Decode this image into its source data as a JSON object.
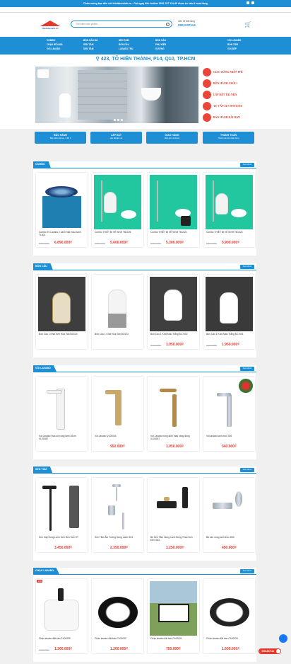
{
  "topbar": {
    "notice": "Chào mừng bạn đến với thietbivesinh.vn - Gọi ngay đến hotline 0901 237 114 để được tư vấn & mua hàng"
  },
  "header": {
    "search_placeholder": "Tìm kiếm sản phẩm...",
    "hotline_label": "Liên hệ đặt hàng",
    "hotline": "0901237114",
    "logo_text": "thietbivesinh.vn"
  },
  "menu": [
    [
      "COMBO",
      "CHẬU RỬA ĐÁ",
      "VÒI LAVABO"
    ],
    [
      "BỒN CẦU ĐÁ",
      "SEN TẮM",
      "SEN TẮM"
    ],
    [
      "SEN TẮM",
      "BỒN CẦU",
      "LAVABO TRỤ"
    ],
    [
      "BỒN CẦU",
      "PHỤ KIỆN",
      "GƯƠNG"
    ],
    [
      "VÒI LAVABO",
      "BỒN TẮM",
      "VÒI BẾP"
    ]
  ],
  "address": "423, TÔ HIẾN THÀNH, P14, Q10, TP.HCM",
  "perks": [
    "GIAO HÀNG MIỄN PHÍ",
    "BỒN HÀNH 1 ĐỔI 1",
    "LẮP ĐẶT TẠI NHÀ",
    "TƯ VẤN 24/7 HOTLINE",
    "BẢO HÀNH DÀI HẠN"
  ],
  "services": [
    {
      "title": "BẢO HÀNH",
      "sub": "Bảo hành dài hạn, 1 đổi 1"
    },
    {
      "title": "LẮP ĐẶT",
      "sub": "Lắp đặt tận nơi"
    },
    {
      "title": "GIAO HÀNG",
      "sub": "Miễn phí nội thành"
    },
    {
      "title": "THANH TOÁN",
      "sub": "Thanh toán khi nhận hàng"
    }
  ],
  "more_label": "Xem tất cả",
  "sections": [
    {
      "title": "COMBO",
      "products": [
        {
          "name": "Combo Tủ Lavabo 2 cánh mặt màu xanh TL601",
          "old": "6.890.000₫",
          "price": "6.890.000₫"
        },
        {
          "name": "Combo THIẾT BỊ VỆ SINH TB1026",
          "old": "6.800.000₫",
          "price": "5.600.000₫"
        },
        {
          "name": "Combo THIẾT BỊ VỆ SINH TB1024",
          "old": "6.800.000₫",
          "price": "5.300.000₫"
        },
        {
          "name": "Combo THIẾT BỊ VỆ SINH TB1023",
          "old": "6.800.000₫",
          "price": "5.900.000₫"
        }
      ]
    },
    {
      "title": "BỒN CẦU",
      "products": [
        {
          "name": "Bồn Cầu 1 Khối Sen Hoa Văn BC024",
          "old": "",
          "price": ""
        },
        {
          "name": "Bồn Cầu 1 Khối Hoa Văn BC023",
          "old": "",
          "price": ""
        },
        {
          "name": "Bồn Cầu 1 Khối Màu Trắng BC7002",
          "old": "2.400.000₫",
          "price": "1.950.000₫"
        },
        {
          "name": "Bồn Cầu 1 Khối Màu Trắng BC7001",
          "old": "2.400.000₫",
          "price": "1.950.000₫"
        }
      ]
    },
    {
      "title": "VÒI LAVABO",
      "products": [
        {
          "name": "Vòi Lavabo Hoa sứ nóng lạnh 30cm VL00047",
          "old": "",
          "price": ""
        },
        {
          "name": "Vòi Lavabo VL00044",
          "old": "",
          "price": "950.000₫"
        },
        {
          "name": "Vòi Lavabo nóng lạnh màu vàng đồng VL00037",
          "old": "",
          "price": "1.050.000₫"
        },
        {
          "name": "Vòi lavabo lạnh Inox 304",
          "old": "",
          "price": "340.000₫"
        }
      ]
    },
    {
      "title": "SEN TẮM",
      "products": [
        {
          "name": "Sen Cây Nóng Lạnh Sơn Đen Sơn ST",
          "old": "",
          "price": "3.450.000₫"
        },
        {
          "name": "Sen Tắm Âm Tường Nóng Lạnh S03",
          "old": "",
          "price": "2.350.000₫"
        },
        {
          "name": "Bộ Sen Tắm Nóng Lạnh Đồng Thau Sơn Đen S63",
          "old": "",
          "price": "1.250.000₫"
        },
        {
          "name": "Bộ sen nóng lạnh Inox S63",
          "old": "",
          "price": "450.000₫"
        }
      ]
    },
    {
      "title": "CHẬU LAVABO",
      "products": [
        {
          "name": "Chậu lavabo đặt bàn CL00030",
          "old": "2.400.000₫",
          "price": "1.300.000₫"
        },
        {
          "name": "Chậu lavabo đặt bàn CL00032",
          "old": "",
          "price": "1.200.000₫"
        },
        {
          "name": "Chậu lavabo đặt bàn CL00031",
          "old": "",
          "price": "750.000₫"
        },
        {
          "name": "Chậu lavabo đặt bàn CL00033",
          "old": "",
          "price": "1.600.000₫"
        }
      ]
    }
  ],
  "floating_phone": "0901237114",
  "colors": {
    "primary": "#1e8fd5",
    "price": "#e23b2e"
  }
}
